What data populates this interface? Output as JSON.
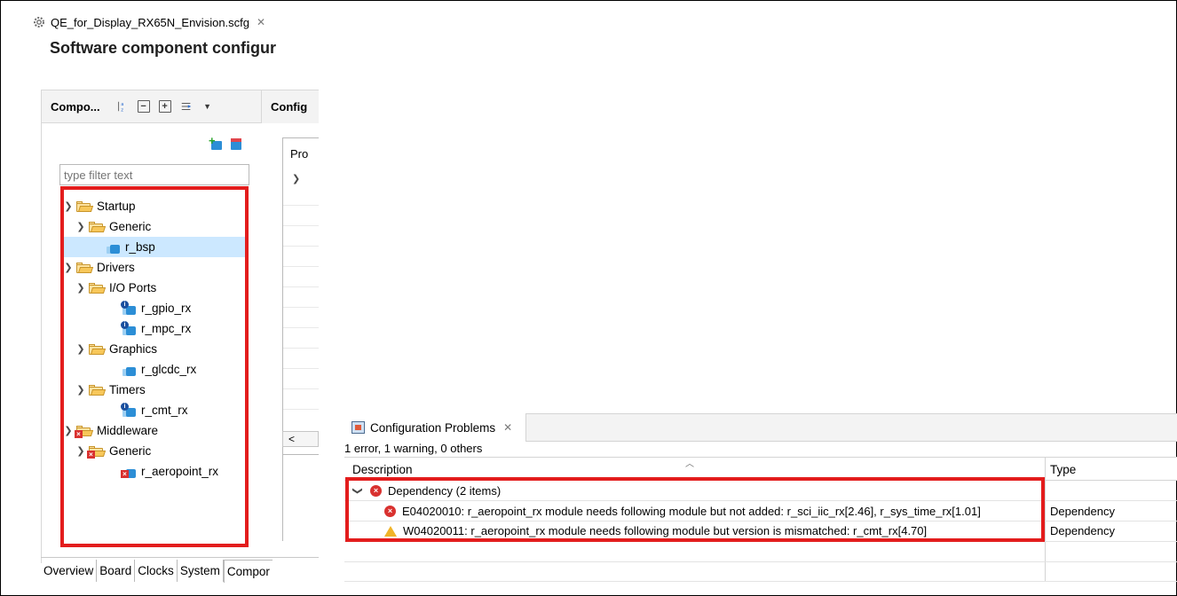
{
  "editor": {
    "tab_title": "QE_for_Display_RX65N_Envision.scfg",
    "close_glyph": "✕",
    "page_title": "Software component configur"
  },
  "components_panel": {
    "title": "Compo...",
    "toolbar_icons": [
      "sort-az-icon",
      "collapse-all-icon",
      "expand-all-icon",
      "filter-icon",
      "view-menu-icon"
    ],
    "filter_placeholder": "type filter text",
    "tree": {
      "startup": "Startup",
      "startup_generic": "Generic",
      "r_bsp": "r_bsp",
      "drivers": "Drivers",
      "io_ports": "I/O Ports",
      "r_gpio_rx": "r_gpio_rx",
      "r_mpc_rx": "r_mpc_rx",
      "graphics": "Graphics",
      "r_glcdc_rx": "r_glcdc_rx",
      "timers": "Timers",
      "r_cmt_rx": "r_cmt_rx",
      "middleware": "Middleware",
      "middleware_generic": "Generic",
      "r_aeropoint_rx": "r_aeropoint_rx"
    }
  },
  "config_panel": {
    "title": "Config",
    "property_header": "Pro",
    "scroll_left": "<"
  },
  "bottom_tabs": [
    "Overview",
    "Board",
    "Clocks",
    "System",
    "Compor"
  ],
  "problems": {
    "tab_title": "Configuration Problems",
    "close_glyph": "✕",
    "summary": "1 error, 1 warning, 0 others",
    "columns": {
      "description": "Description",
      "type": "Type"
    },
    "group": "Dependency (2 items)",
    "rows": [
      {
        "severity": "error",
        "description": "E04020010: r_aeropoint_rx module needs following module but not added: r_sci_iic_rx[2.46], r_sys_time_rx[1.01]",
        "type": "Dependency"
      },
      {
        "severity": "warning",
        "description": "W04020011: r_aeropoint_rx module needs following module but version is mismatched: r_cmt_rx[4.70]",
        "type": "Dependency"
      }
    ]
  },
  "colors": {
    "highlight_red": "#e31d1d",
    "selection_blue": "#cce8ff",
    "component_blue": "#2c8ed6",
    "error_red": "#d9312f",
    "warning_yellow": "#f0b429"
  }
}
